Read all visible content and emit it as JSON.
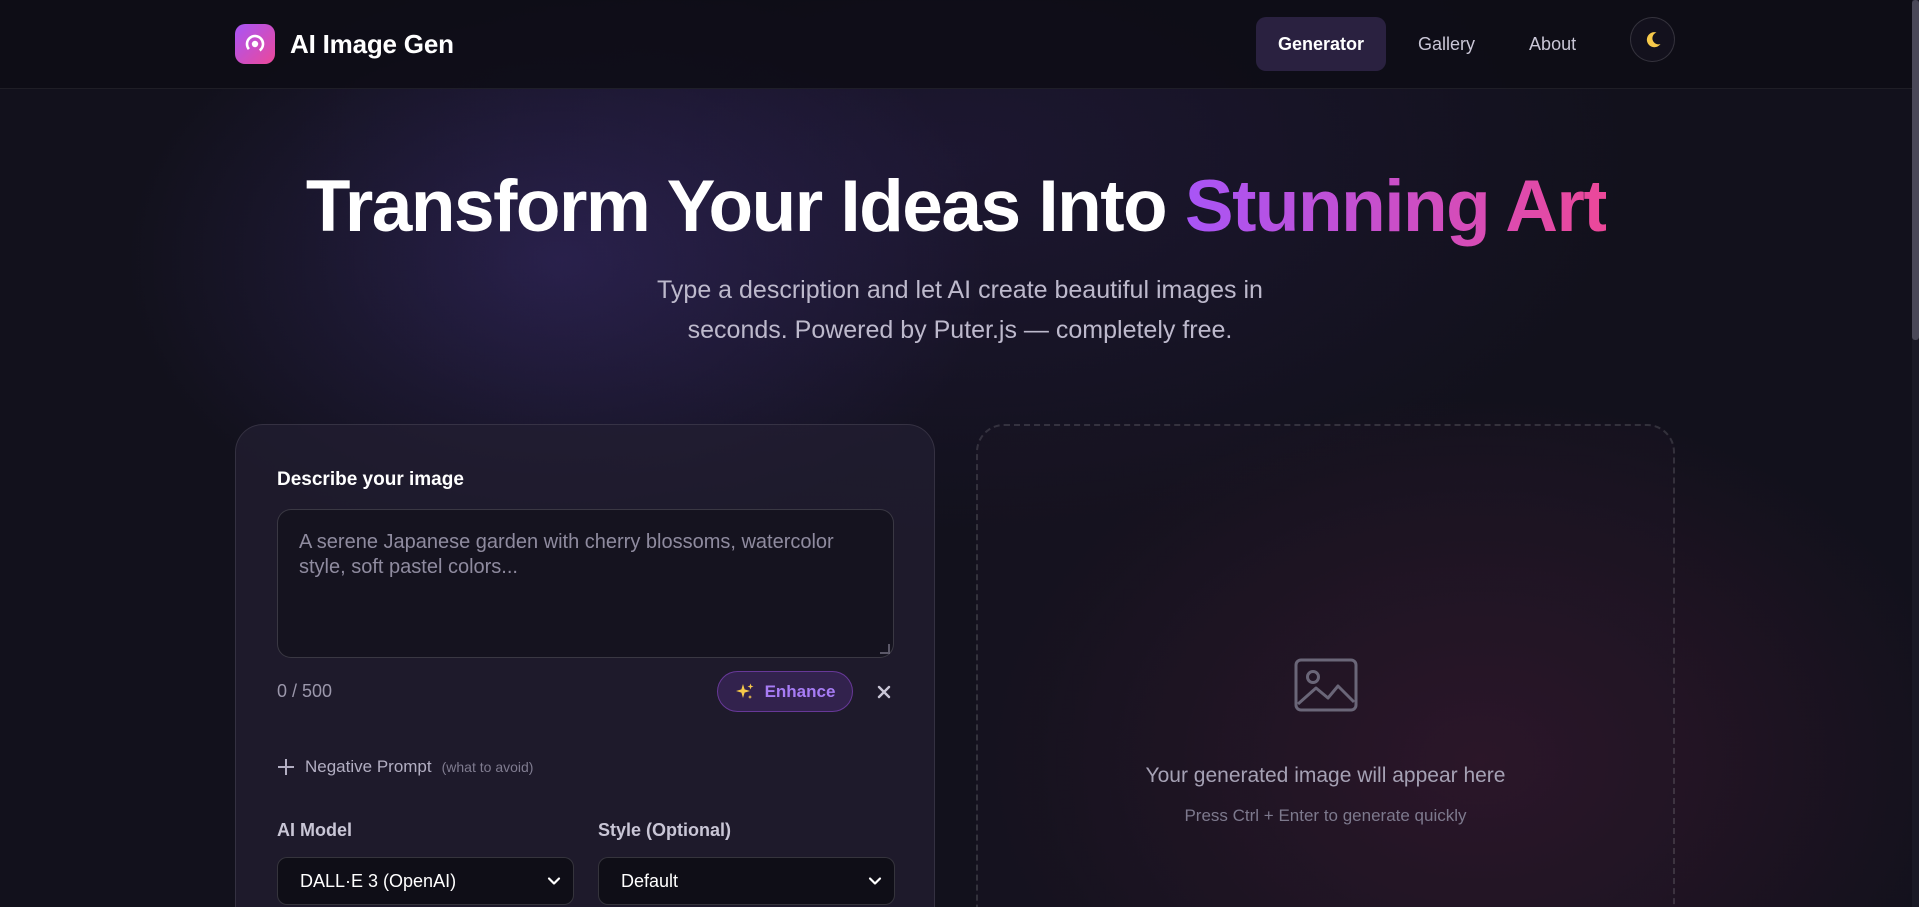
{
  "header": {
    "app_name": "AI Image Gen",
    "nav": [
      {
        "label": "Generator",
        "active": true
      },
      {
        "label": "Gallery",
        "active": false
      },
      {
        "label": "About",
        "active": false
      }
    ],
    "theme_icon": "moon-icon"
  },
  "hero": {
    "title_plain": "Transform Your Ideas Into ",
    "title_accent": "Stunning Art",
    "subtitle": "Type a description and let AI create beautiful images in seconds. Powered by Puter.js — completely free."
  },
  "form": {
    "prompt_label": "Describe your image",
    "prompt_placeholder": "A serene Japanese garden with cherry blossoms, watercolor style, soft pastel colors...",
    "prompt_value": "",
    "char_count": "0 / 500",
    "enhance_label": "Enhance",
    "enhance_icon": "sparkles-icon",
    "clear_icon": "close-icon",
    "negative_prompt_label": "Negative Prompt",
    "negative_prompt_hint": "(what to avoid)",
    "model_label": "AI Model",
    "model_value": "DALL·E 3 (OpenAI)",
    "style_label": "Style (Optional)",
    "style_value": "Default"
  },
  "preview": {
    "icon": "image-icon",
    "title": "Your generated image will appear here",
    "hint": "Press Ctrl + Enter to generate quickly"
  },
  "colors": {
    "accent_start": "#a855f7",
    "accent_end": "#ec4899",
    "background": "#12111c"
  }
}
